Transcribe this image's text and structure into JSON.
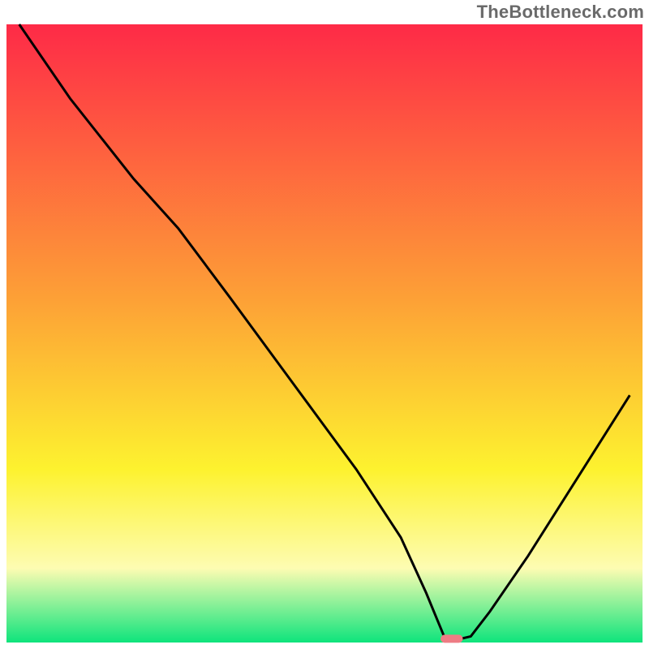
{
  "watermark": "TheBottleneck.com",
  "colors": {
    "red": "#fe2a47",
    "orange": "#fda236",
    "yellow": "#fdf22f",
    "paleYellow": "#fdfcb2",
    "green": "#0ee47c",
    "lineStroke": "#000000",
    "markerFill": "#ee7c84",
    "watermarkText": "#6a6a6a"
  },
  "chart_data": {
    "type": "line",
    "title": "",
    "xlabel": "",
    "ylabel": "",
    "xlim": [
      0,
      100
    ],
    "ylim": [
      0,
      100
    ],
    "grid": false,
    "legend": false,
    "x": [
      2,
      10,
      20,
      27,
      35,
      45,
      55,
      62,
      66,
      68,
      69,
      71,
      73,
      76,
      82,
      90,
      98
    ],
    "values": [
      100,
      88,
      75,
      67,
      56,
      42,
      28,
      17,
      8,
      3,
      0.5,
      0.5,
      1,
      5,
      14,
      27,
      40
    ],
    "annotations": [
      {
        "kind": "optimum-marker",
        "x": 70,
        "y": 0.6,
        "width_x": 3.5,
        "color": "#ee7c84"
      }
    ],
    "background": {
      "type": "vertical-gradient",
      "stops": [
        {
          "pos": 0.0,
          "color": "#fe2a47"
        },
        {
          "pos": 0.45,
          "color": "#fda236"
        },
        {
          "pos": 0.72,
          "color": "#fdf22f"
        },
        {
          "pos": 0.88,
          "color": "#fdfcb2"
        },
        {
          "pos": 1.0,
          "color": "#0ee47c"
        }
      ]
    }
  }
}
